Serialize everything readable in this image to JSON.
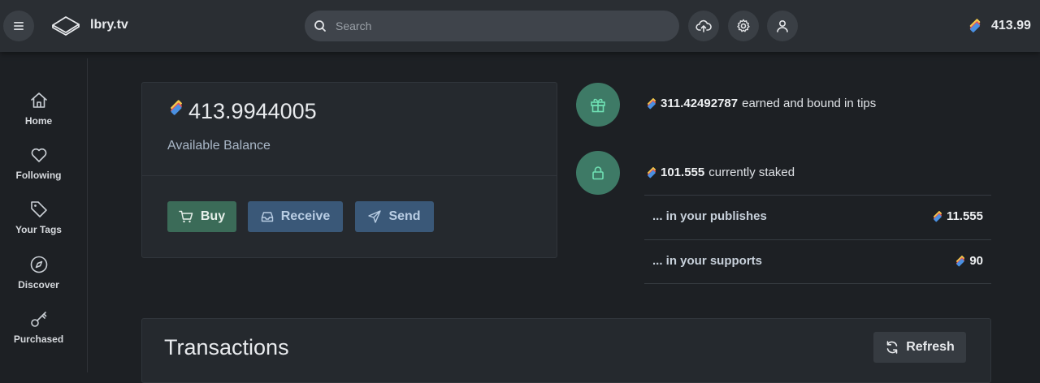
{
  "header": {
    "brand": "lbry.tv",
    "search_placeholder": "Search",
    "balance": "413.99"
  },
  "sidebar": {
    "items": [
      {
        "label": "Home",
        "icon": "home-icon"
      },
      {
        "label": "Following",
        "icon": "heart-icon"
      },
      {
        "label": "Your Tags",
        "icon": "tag-icon"
      },
      {
        "label": "Discover",
        "icon": "compass-icon"
      },
      {
        "label": "Purchased",
        "icon": "key-icon"
      }
    ]
  },
  "wallet": {
    "balance": "413.9944005",
    "balance_label": "Available Balance",
    "buy_label": "Buy",
    "receive_label": "Receive",
    "send_label": "Send"
  },
  "stats": {
    "tips_amount": "311.42492787",
    "tips_text": "earned and bound in tips",
    "staked_amount": "101.555",
    "staked_text": "currently staked",
    "publishes_label": "... in your publishes",
    "publishes_value": "11.555",
    "supports_label": "... in your supports",
    "supports_value": "90"
  },
  "transactions": {
    "title": "Transactions",
    "refresh_label": "Refresh"
  },
  "colors": {
    "accent_green": "#3e7a66",
    "button_blue": "#3a5878",
    "buy_green": "#3b6b58"
  }
}
